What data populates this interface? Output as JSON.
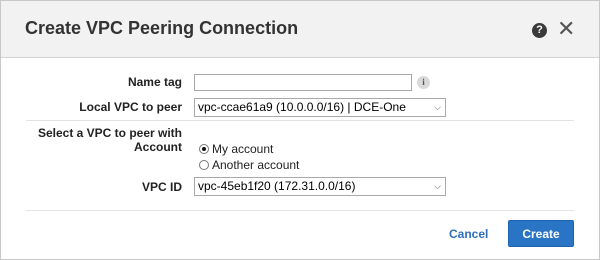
{
  "dialog": {
    "title": "Create VPC Peering Connection",
    "help_icon": "?",
    "close_icon": "✕"
  },
  "form": {
    "name_tag": {
      "label": "Name tag",
      "value": "",
      "info_icon": "i"
    },
    "local_vpc": {
      "label": "Local VPC to peer",
      "selected": "vpc-ccae61a9 (10.0.0.0/16) | DCE-One"
    },
    "peer_section": {
      "heading_line1": "Select a VPC to peer with",
      "account_label": "Account",
      "options": [
        {
          "label": "My account",
          "selected": true
        },
        {
          "label": "Another account",
          "selected": false
        }
      ]
    },
    "vpc_id": {
      "label": "VPC ID",
      "selected": "vpc-45eb1f20 (172.31.0.0/16)"
    }
  },
  "footer": {
    "cancel_label": "Cancel",
    "create_label": "Create"
  },
  "colors": {
    "primary_button": "#2a74c6",
    "link": "#2e6fbd"
  }
}
